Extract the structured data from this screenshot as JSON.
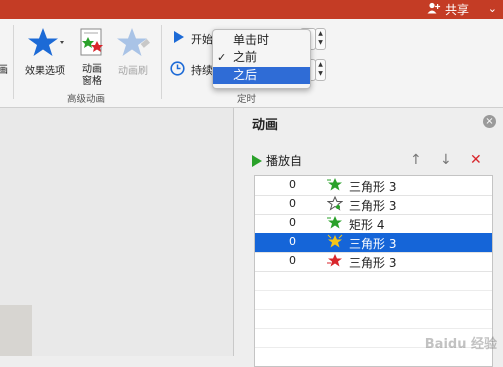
{
  "topbar": {
    "share_label": "共享",
    "user_icon": "add-user-icon",
    "chevron": "⌄",
    "color": "#c43c25"
  },
  "ribbon": {
    "left_partial_label": "画",
    "effect_options_label": "效果选项",
    "animation_pane_label": "动画\n窗格",
    "animation_brush_label": "动画刷",
    "advanced_group_label": "高级动画",
    "timing_group_label": "定时",
    "start_label": "开始",
    "duration_label": "持续"
  },
  "start_dropdown": {
    "options": [
      {
        "label": "单击时",
        "checked": false,
        "selected": false
      },
      {
        "label": "之前",
        "checked": true,
        "selected": false
      },
      {
        "label": "之后",
        "checked": false,
        "selected": true
      }
    ],
    "check_glyph": "✓",
    "highlight_color": "#2f6cd6"
  },
  "pane": {
    "title": "动画",
    "close_glyph": "×",
    "play_label": "播放自",
    "up_glyph": "↑",
    "down_glyph": "↓",
    "delete_glyph": "✕",
    "rows": [
      {
        "order": "0",
        "name": "三角形 3",
        "effect": "entrance-green",
        "selected": false
      },
      {
        "order": "0",
        "name": "三角形 3",
        "effect": "emphasis-outline",
        "selected": false
      },
      {
        "order": "0",
        "name": "矩形 4",
        "effect": "entrance-green",
        "selected": false
      },
      {
        "order": "0",
        "name": "三角形 3",
        "effect": "emphasis-yellow",
        "selected": true
      },
      {
        "order": "0",
        "name": "三角形 3",
        "effect": "exit-red",
        "selected": false
      }
    ],
    "selection_color": "#1565d8"
  },
  "watermark": "Baidu 经验"
}
